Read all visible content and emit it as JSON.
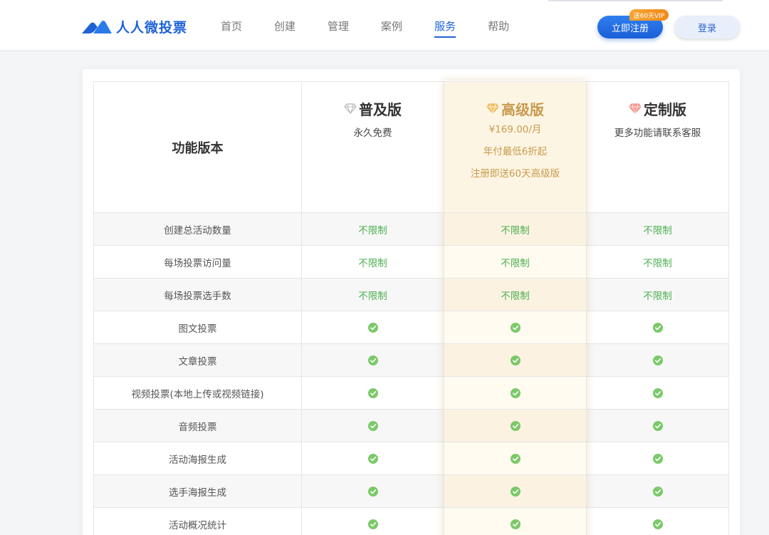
{
  "brand": {
    "name": "人人微投票",
    "accent": "#1e62d8"
  },
  "nav": {
    "items": [
      {
        "label": "首页",
        "active": false
      },
      {
        "label": "创建",
        "active": false
      },
      {
        "label": "管理",
        "active": false
      },
      {
        "label": "案例",
        "active": false
      },
      {
        "label": "服务",
        "active": true
      },
      {
        "label": "帮助",
        "active": false
      }
    ]
  },
  "header_actions": {
    "register_label": "立即注册",
    "vip_badge": "送60天VIP",
    "login_label": "登录"
  },
  "table": {
    "header_label": "功能版本",
    "plans": [
      {
        "name": "普及版",
        "icon": "diamond-gray-icon",
        "lines": [
          "永久免费"
        ]
      },
      {
        "name": "高级版",
        "icon": "diamond-gold-icon",
        "lines": [
          "¥169.00/月",
          "年付最低6折起",
          "注册即送60天高级版"
        ]
      },
      {
        "name": "定制版",
        "icon": "diamond-red-icon",
        "lines": [
          "更多功能请联系客服"
        ]
      }
    ],
    "rows": [
      {
        "feature": "创建总活动数量",
        "values": [
          "不限制",
          "不限制",
          "不限制"
        ]
      },
      {
        "feature": "每场投票访问量",
        "values": [
          "不限制",
          "不限制",
          "不限制"
        ]
      },
      {
        "feature": "每场投票选手数",
        "values": [
          "不限制",
          "不限制",
          "不限制"
        ]
      },
      {
        "feature": "图文投票",
        "values": [
          "check",
          "check",
          "check"
        ]
      },
      {
        "feature": "文章投票",
        "values": [
          "check",
          "check",
          "check"
        ]
      },
      {
        "feature": "视频投票(本地上传或视频链接)",
        "values": [
          "check",
          "check",
          "check"
        ]
      },
      {
        "feature": "音频投票",
        "values": [
          "check",
          "check",
          "check"
        ]
      },
      {
        "feature": "活动海报生成",
        "values": [
          "check",
          "check",
          "check"
        ]
      },
      {
        "feature": "选手海报生成",
        "values": [
          "check",
          "check",
          "check"
        ]
      },
      {
        "feature": "活动概况统计",
        "values": [
          "check",
          "check",
          "check"
        ]
      }
    ],
    "colors": {
      "check": "#7cc96a",
      "unlimited": "#4caf50",
      "gold": "#c89a4e"
    }
  }
}
